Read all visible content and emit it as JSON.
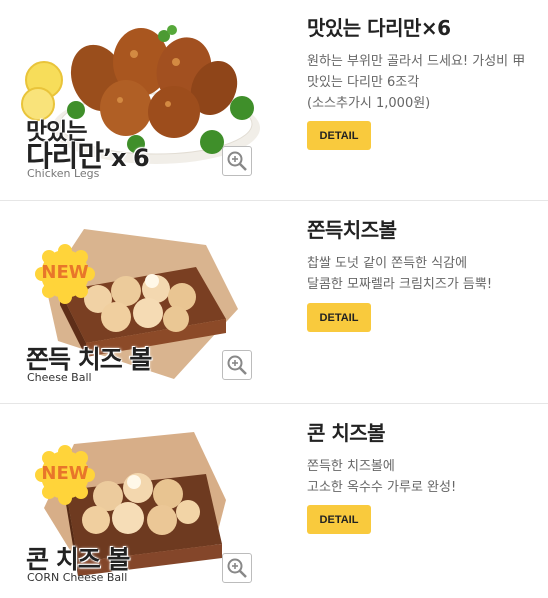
{
  "items": [
    {
      "name": "맛있는 다리만×6",
      "desc_lines": [
        "원하는 부위만 골라서 드세요! 가성비 甲",
        "맛있는 다리만 6조각",
        "(소스추가시 1,000원)"
      ],
      "button": "DETAIL",
      "art_title": "맛있는 다리만’x 6",
      "art_title_l1": "맛있는",
      "art_title_l2": "다리만",
      "art_title_x": "’x 6",
      "art_sub": "Chicken Legs",
      "badge": null
    },
    {
      "name": "쫀득치즈볼",
      "desc_lines": [
        "찹쌀 도넛 같이 쫀득한 식감에",
        "달콤한 모짜렐라 크림치즈가 듬뿍!"
      ],
      "button": "DETAIL",
      "art_title": "쫀득 치즈 볼",
      "art_sub": "Cheese Ball",
      "badge": "NEW"
    },
    {
      "name": "콘 치즈볼",
      "desc_lines": [
        "쫀득한 치즈볼에",
        "고소한 옥수수 가루로 완성!"
      ],
      "button": "DETAIL",
      "art_title": "콘 치즈 볼",
      "art_sub": "CORN Cheese Ball",
      "badge": "NEW"
    }
  ],
  "icons": {
    "zoom": "zoom-in-icon",
    "badge": "new-badge-icon"
  },
  "colors": {
    "button_bg": "#f9ca3d",
    "badge_bg": "#ffd43a",
    "badge_text": "#e8762a",
    "divider": "#e6e6e6"
  }
}
